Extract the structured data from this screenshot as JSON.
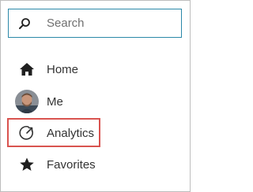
{
  "search": {
    "placeholder": "Search",
    "icon": "search-icon"
  },
  "nav": {
    "items": [
      {
        "label": "Home",
        "icon": "home-icon"
      },
      {
        "label": "Me",
        "icon": "avatar"
      },
      {
        "label": "Analytics",
        "icon": "analytics-icon",
        "highlighted": true
      },
      {
        "label": "Favorites",
        "icon": "star-icon"
      }
    ]
  },
  "colors": {
    "search_border": "#2b88a8",
    "highlight": "#d9534f",
    "text": "#333333"
  }
}
